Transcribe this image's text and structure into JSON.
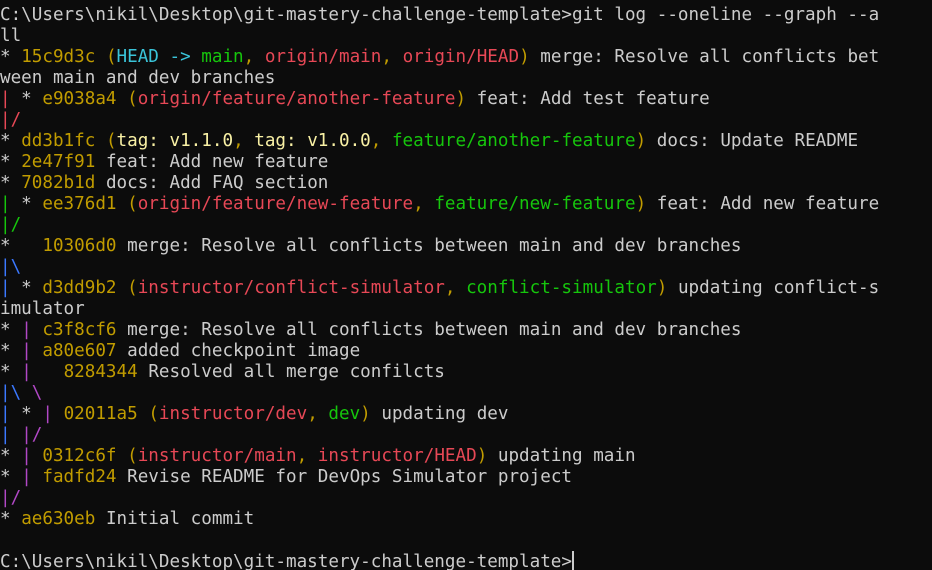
{
  "colors": {
    "background": "#0c0c0c",
    "text": "#cccccc",
    "hash": "#c19c00",
    "head": "#3ac4d9",
    "local_branch": "#16c60c",
    "remote_branch": "#e74856",
    "tag": "#f9f1a5",
    "decoration_paren": "#c19c00",
    "graph_red": "#e74856",
    "graph_green": "#16c60c",
    "graph_blue": "#3b78ff",
    "graph_magenta": "#b148c6"
  },
  "lines": [
    [
      {
        "t": "C:\\Users\\nikil\\Desktop\\git-mastery-challenge-template>git log --oneline --graph --a",
        "c": "text"
      }
    ],
    [
      {
        "t": "ll",
        "c": "text"
      }
    ],
    [
      {
        "t": "* ",
        "c": "text"
      },
      {
        "t": "15c9d3c ",
        "c": "hash"
      },
      {
        "t": "(",
        "c": "decoration_paren"
      },
      {
        "t": "HEAD -> ",
        "c": "head"
      },
      {
        "t": "main",
        "c": "local_branch"
      },
      {
        "t": ", ",
        "c": "decoration_paren"
      },
      {
        "t": "origin/main",
        "c": "remote_branch"
      },
      {
        "t": ", ",
        "c": "decoration_paren"
      },
      {
        "t": "origin/HEAD",
        "c": "remote_branch"
      },
      {
        "t": ")",
        "c": "decoration_paren"
      },
      {
        "t": " merge: Resolve all conflicts bet",
        "c": "text"
      }
    ],
    [
      {
        "t": "ween main and dev branches",
        "c": "text"
      }
    ],
    [
      {
        "t": "|",
        "c": "graph_red"
      },
      {
        "t": " * ",
        "c": "text"
      },
      {
        "t": "e9038a4 ",
        "c": "hash"
      },
      {
        "t": "(",
        "c": "decoration_paren"
      },
      {
        "t": "origin/feature/another-feature",
        "c": "remote_branch"
      },
      {
        "t": ")",
        "c": "decoration_paren"
      },
      {
        "t": " feat: Add test feature",
        "c": "text"
      }
    ],
    [
      {
        "t": "|/",
        "c": "graph_red"
      }
    ],
    [
      {
        "t": "* ",
        "c": "text"
      },
      {
        "t": "dd3b1fc ",
        "c": "hash"
      },
      {
        "t": "(",
        "c": "decoration_paren"
      },
      {
        "t": "tag: v1.1.0",
        "c": "tag"
      },
      {
        "t": ", ",
        "c": "decoration_paren"
      },
      {
        "t": "tag: v1.0.0",
        "c": "tag"
      },
      {
        "t": ", ",
        "c": "decoration_paren"
      },
      {
        "t": "feature/another-feature",
        "c": "local_branch"
      },
      {
        "t": ")",
        "c": "decoration_paren"
      },
      {
        "t": " docs: Update README",
        "c": "text"
      }
    ],
    [
      {
        "t": "* ",
        "c": "text"
      },
      {
        "t": "2e47f91 ",
        "c": "hash"
      },
      {
        "t": "feat: Add new feature",
        "c": "text"
      }
    ],
    [
      {
        "t": "* ",
        "c": "text"
      },
      {
        "t": "7082b1d ",
        "c": "hash"
      },
      {
        "t": "docs: Add FAQ section",
        "c": "text"
      }
    ],
    [
      {
        "t": "|",
        "c": "graph_green"
      },
      {
        "t": " * ",
        "c": "text"
      },
      {
        "t": "ee376d1 ",
        "c": "hash"
      },
      {
        "t": "(",
        "c": "decoration_paren"
      },
      {
        "t": "origin/feature/new-feature",
        "c": "remote_branch"
      },
      {
        "t": ", ",
        "c": "decoration_paren"
      },
      {
        "t": "feature/new-feature",
        "c": "local_branch"
      },
      {
        "t": ")",
        "c": "decoration_paren"
      },
      {
        "t": " feat: Add new feature",
        "c": "text"
      }
    ],
    [
      {
        "t": "|/",
        "c": "graph_green"
      }
    ],
    [
      {
        "t": "*   ",
        "c": "text"
      },
      {
        "t": "10306d0 ",
        "c": "hash"
      },
      {
        "t": "merge: Resolve all conflicts between main and dev branches",
        "c": "text"
      }
    ],
    [
      {
        "t": "|\\",
        "c": "graph_blue"
      }
    ],
    [
      {
        "t": "|",
        "c": "graph_blue"
      },
      {
        "t": " * ",
        "c": "text"
      },
      {
        "t": "d3dd9b2 ",
        "c": "hash"
      },
      {
        "t": "(",
        "c": "decoration_paren"
      },
      {
        "t": "instructor/conflict-simulator",
        "c": "remote_branch"
      },
      {
        "t": ", ",
        "c": "decoration_paren"
      },
      {
        "t": "conflict-simulator",
        "c": "local_branch"
      },
      {
        "t": ")",
        "c": "decoration_paren"
      },
      {
        "t": " updating conflict-s",
        "c": "text"
      }
    ],
    [
      {
        "t": "imulator",
        "c": "text"
      }
    ],
    [
      {
        "t": "* ",
        "c": "text"
      },
      {
        "t": "|",
        "c": "graph_magenta"
      },
      {
        "t": " ",
        "c": "text"
      },
      {
        "t": "c3f8cf6 ",
        "c": "hash"
      },
      {
        "t": "merge: Resolve all conflicts between main and dev branches",
        "c": "text"
      }
    ],
    [
      {
        "t": "* ",
        "c": "text"
      },
      {
        "t": "|",
        "c": "graph_magenta"
      },
      {
        "t": " ",
        "c": "text"
      },
      {
        "t": "a80e607 ",
        "c": "hash"
      },
      {
        "t": "added checkpoint image",
        "c": "text"
      }
    ],
    [
      {
        "t": "* ",
        "c": "text"
      },
      {
        "t": "|",
        "c": "graph_magenta"
      },
      {
        "t": "   ",
        "c": "text"
      },
      {
        "t": "8284344 ",
        "c": "hash"
      },
      {
        "t": "Resolved all merge confilcts",
        "c": "text"
      }
    ],
    [
      {
        "t": "|\\",
        "c": "graph_blue"
      },
      {
        "t": " ",
        "c": "text"
      },
      {
        "t": "\\",
        "c": "graph_magenta"
      }
    ],
    [
      {
        "t": "|",
        "c": "graph_blue"
      },
      {
        "t": " * ",
        "c": "text"
      },
      {
        "t": "|",
        "c": "graph_magenta"
      },
      {
        "t": " ",
        "c": "text"
      },
      {
        "t": "02011a5 ",
        "c": "hash"
      },
      {
        "t": "(",
        "c": "decoration_paren"
      },
      {
        "t": "instructor/dev",
        "c": "remote_branch"
      },
      {
        "t": ", ",
        "c": "decoration_paren"
      },
      {
        "t": "dev",
        "c": "local_branch"
      },
      {
        "t": ")",
        "c": "decoration_paren"
      },
      {
        "t": " updating dev",
        "c": "text"
      }
    ],
    [
      {
        "t": "|",
        "c": "graph_blue"
      },
      {
        "t": " ",
        "c": "text"
      },
      {
        "t": "|/",
        "c": "graph_magenta"
      }
    ],
    [
      {
        "t": "* ",
        "c": "text"
      },
      {
        "t": "|",
        "c": "graph_magenta"
      },
      {
        "t": " ",
        "c": "text"
      },
      {
        "t": "0312c6f ",
        "c": "hash"
      },
      {
        "t": "(",
        "c": "decoration_paren"
      },
      {
        "t": "instructor/main",
        "c": "remote_branch"
      },
      {
        "t": ", ",
        "c": "decoration_paren"
      },
      {
        "t": "instructor/HEAD",
        "c": "remote_branch"
      },
      {
        "t": ")",
        "c": "decoration_paren"
      },
      {
        "t": " updating main",
        "c": "text"
      }
    ],
    [
      {
        "t": "* ",
        "c": "text"
      },
      {
        "t": "|",
        "c": "graph_magenta"
      },
      {
        "t": " ",
        "c": "text"
      },
      {
        "t": "fadfd24 ",
        "c": "hash"
      },
      {
        "t": "Revise README for DevOps Simulator project",
        "c": "text"
      }
    ],
    [
      {
        "t": "|/",
        "c": "graph_magenta"
      }
    ],
    [
      {
        "t": "* ",
        "c": "text"
      },
      {
        "t": "ae630eb ",
        "c": "hash"
      },
      {
        "t": "Initial commit",
        "c": "text"
      }
    ],
    [
      {
        "t": "",
        "c": "text"
      }
    ],
    [
      {
        "t": "C:\\Users\\nikil\\Desktop\\git-mastery-challenge-template>",
        "c": "text"
      }
    ]
  ]
}
